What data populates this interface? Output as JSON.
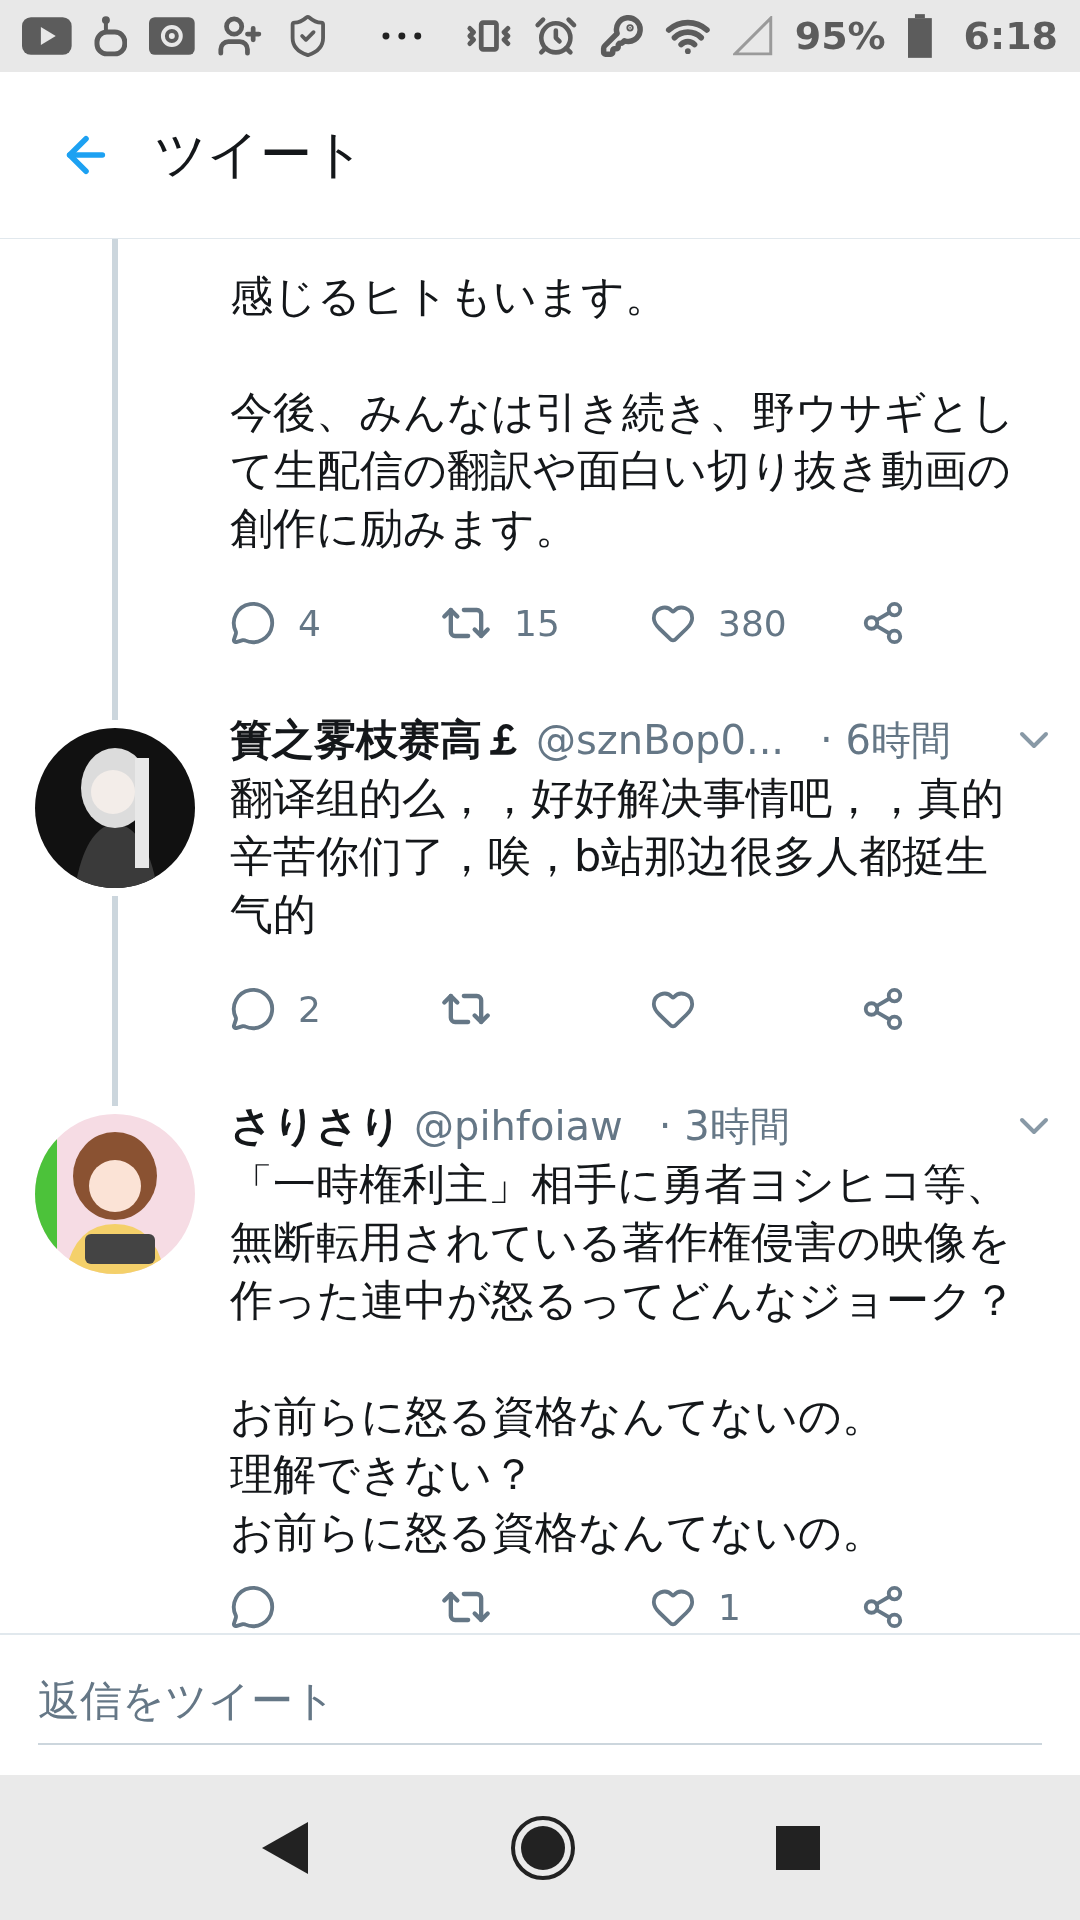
{
  "status_bar": {
    "battery": "95%",
    "time": "6:18"
  },
  "header": {
    "title": "ツイート"
  },
  "tweets": [
    {
      "paragraphs": [
        [
          "感じるヒトもいます。"
        ],
        [
          "今後、みんなは引き続き、野ウサギとし",
          "て生配信の翻訳や面白い切り抜き動画の",
          "創作に励みます。"
        ]
      ],
      "actions": {
        "replies": "4",
        "retweets": "15",
        "likes": "380"
      }
    },
    {
      "name": "簣之雾枝赛高￡",
      "handle": "@sznBop0...",
      "time": "· 6時間",
      "avatar": {
        "kind": "picture"
      },
      "paragraphs": [
        [
          "翻译组的么，，好好解决事情吧，，真的",
          "辛苦你们了，唉，b站那边很多人都挺生",
          "气的"
        ]
      ],
      "actions": {
        "replies": "2"
      }
    },
    {
      "name": "さりさり",
      "handle": "@pihfoiaw",
      "time": "· 3時間",
      "avatar": {
        "kind": "picture"
      },
      "paragraphs": [
        [
          "「一時権利主」相手に勇者ヨシヒコ等、",
          "無断転用されている著作権侵害の映像を",
          "作った連中が怒るってどんなジョーク？"
        ],
        [
          "お前らに怒る資格なんてないの。",
          "理解できない？",
          "お前らに怒る資格なんてないの。"
        ]
      ],
      "actions": {
        "likes": "1"
      }
    }
  ],
  "reply_box": {
    "placeholder": "返信をツイート"
  }
}
